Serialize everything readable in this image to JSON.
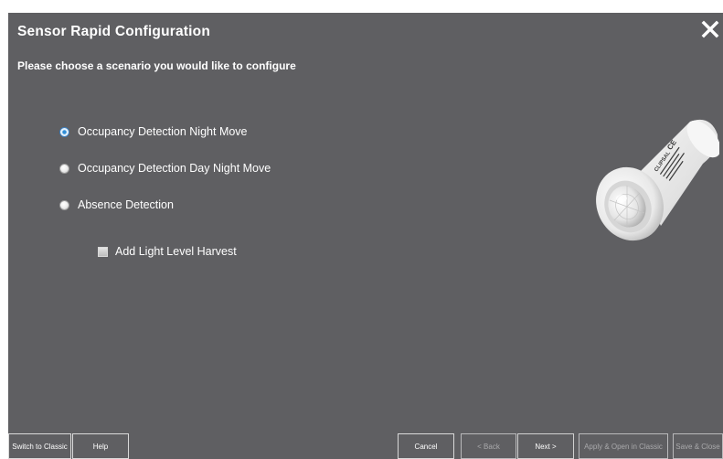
{
  "dialog": {
    "title": "Sensor Rapid Configuration",
    "close_icon": "close-icon",
    "subtitle": "Please choose a scenario you would like to configure"
  },
  "scenarios": [
    {
      "label": "Occupancy Detection Night Move",
      "selected": true
    },
    {
      "label": "Occupancy Detection Day Night Move",
      "selected": false
    },
    {
      "label": "Absence Detection",
      "selected": false
    }
  ],
  "light_level_harvest": {
    "label": "Add Light Level Harvest",
    "checked": false
  },
  "sensor_image": {
    "icon": "ceiling-sensor-image",
    "printed_text": [
      "CLIPSAL",
      "CE"
    ]
  },
  "footer": {
    "switch_to_classic": "Switch to Classic",
    "help": "Help",
    "cancel": "Cancel",
    "back": "< Back",
    "next": "Next >",
    "apply_open_classic": "Apply & Open in Classic",
    "save_close": "Save & Close"
  },
  "colors": {
    "dialog_background": "#5f5f62",
    "text": "#ffffff",
    "radio_selected": "#2f8ed8",
    "disabled_text": "#a9a9ab"
  }
}
